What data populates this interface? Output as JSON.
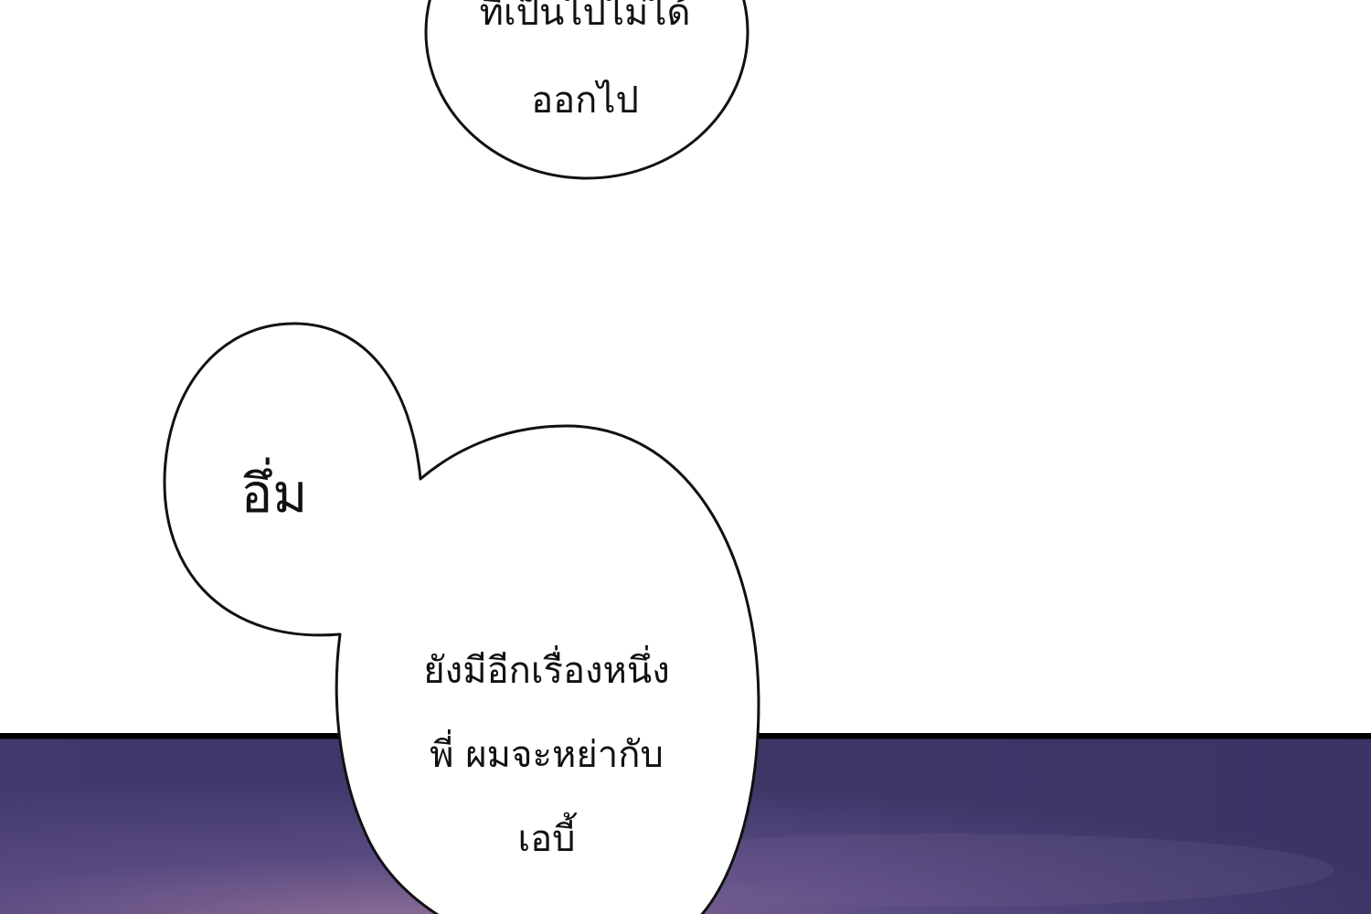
{
  "colors": {
    "background": "#ffffff",
    "panel_border": "#000000",
    "bubble_fill": "#ffffff",
    "bubble_outline": "#111111",
    "sky_dark": "#3d3768",
    "sky_mid": "#5f4f86",
    "sky_glow": "#a07a9f"
  },
  "bubbles": {
    "top": {
      "lines": [
        "ที่เป็นไปไม่ได้",
        "ออกไป"
      ]
    },
    "left": {
      "lines": [
        "อึ่ม"
      ]
    },
    "right": {
      "lines": [
        "ยังมีอีกเรื่องหนึ่ง",
        "พี่ ผมจะหย่ากับ",
        "เอบี้"
      ]
    }
  }
}
